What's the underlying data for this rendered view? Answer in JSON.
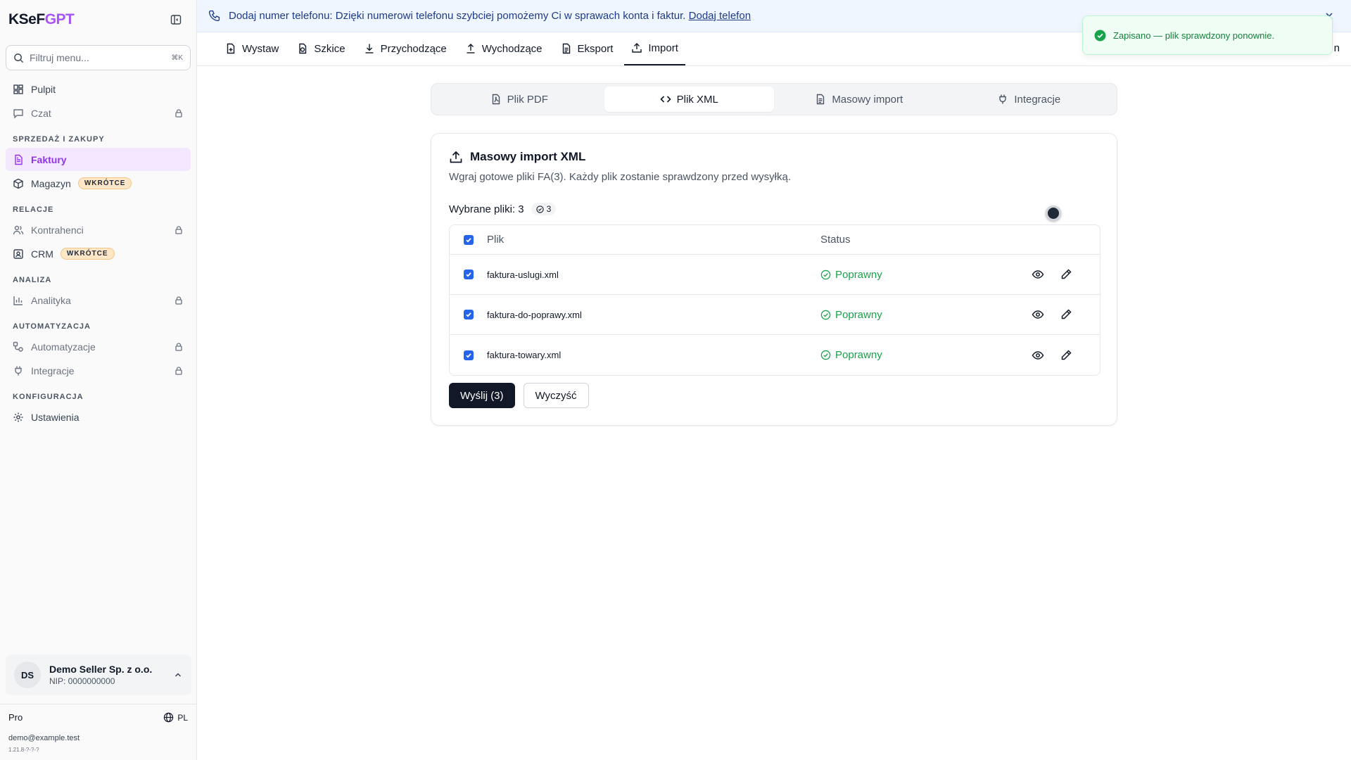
{
  "app": {
    "logo_prefix": "KSeF",
    "logo_suffix": "GPT",
    "accent_color": "#a855f7"
  },
  "sidebar": {
    "filter_placeholder": "Filtruj menu...",
    "filter_shortcut": "⌘K",
    "items": [
      {
        "label": "Pulpit",
        "icon": "dashboard-icon"
      },
      {
        "label": "Czat",
        "icon": "chat-icon",
        "locked": true
      }
    ],
    "sections": [
      {
        "label": "SPRZEDAŻ I ZAKUPY",
        "items": [
          {
            "label": "Faktury",
            "icon": "invoice-icon",
            "active": true
          },
          {
            "label": "Magazyn",
            "icon": "box-icon",
            "badge": "WKRÓTCE"
          }
        ]
      },
      {
        "label": "RELACJE",
        "items": [
          {
            "label": "Kontrahenci",
            "icon": "users-icon",
            "locked": true
          },
          {
            "label": "CRM",
            "icon": "contact-icon",
            "badge": "WKRÓTCE"
          }
        ]
      },
      {
        "label": "ANALIZA",
        "items": [
          {
            "label": "Analityka",
            "icon": "bar-chart-icon",
            "locked": true
          }
        ]
      },
      {
        "label": "AUTOMATYZACJA",
        "items": [
          {
            "label": "Automatyzacje",
            "icon": "workflow-icon",
            "locked": true
          },
          {
            "label": "Integracje",
            "icon": "plug-icon",
            "locked": true
          }
        ]
      },
      {
        "label": "KONFIGURACJA",
        "items": [
          {
            "label": "Ustawienia",
            "icon": "gear-icon"
          }
        ]
      }
    ],
    "account": {
      "initials": "DS",
      "name": "Demo Seller Sp. z o.o.",
      "nip": "NIP: 0000000000"
    },
    "plan": "Pro",
    "language": "PL",
    "email": "demo@example.test",
    "version": "1.21.8-?-?-?"
  },
  "banner": {
    "text": "Dodaj numer telefonu: Dzięki numerowi telefonu szybciej pomożemy Ci w sprawach konta i faktur.",
    "link": "Dodaj telefon"
  },
  "tabs": [
    {
      "label": "Wystaw",
      "icon": "file-plus-icon"
    },
    {
      "label": "Szkice",
      "icon": "draft-icon"
    },
    {
      "label": "Przychodzące",
      "icon": "download-icon"
    },
    {
      "label": "Wychodzące",
      "icon": "upload-icon"
    },
    {
      "label": "Eksport",
      "icon": "file-text-icon"
    },
    {
      "label": "Import",
      "icon": "import-icon",
      "active": true
    }
  ],
  "tab_overflow": "n",
  "subtabs": [
    {
      "label": "Plik PDF",
      "icon": "pdf-file-icon"
    },
    {
      "label": "Plik XML",
      "icon": "code-icon",
      "active": true
    },
    {
      "label": "Masowy import",
      "icon": "document-icon"
    },
    {
      "label": "Integracje",
      "icon": "plug-icon"
    }
  ],
  "card": {
    "title": "Masowy import XML",
    "description": "Wgraj gotowe pliki FA(3). Każdy plik zostanie sprawdzony przed wysyłką.",
    "selected_label": "Wybrane pliki: 3",
    "selected_count": "3",
    "table": {
      "headers": {
        "file": "Plik",
        "status": "Status"
      },
      "rows": [
        {
          "file": "faktura-uslugi.xml",
          "status": "Poprawny"
        },
        {
          "file": "faktura-do-poprawy.xml",
          "status": "Poprawny"
        },
        {
          "file": "faktura-towary.xml",
          "status": "Poprawny"
        }
      ]
    },
    "send_button": "Wyślij (3)",
    "clear_button": "Wyczyść"
  },
  "toast": {
    "text": "Zapisano — plik sprawdzony ponownie.",
    "color": "#16a34a"
  }
}
